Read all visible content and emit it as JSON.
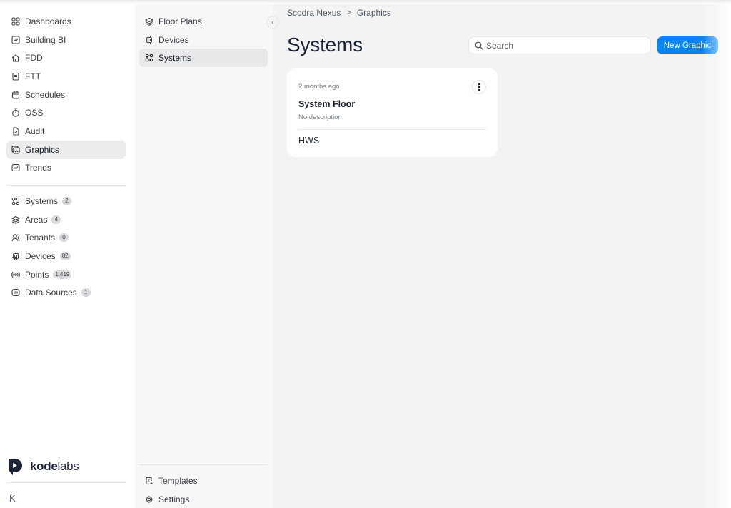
{
  "sidebar": {
    "items": [
      {
        "label": "Dashboards",
        "icon": "dashboard-icon"
      },
      {
        "label": "Building BI",
        "icon": "chart-icon"
      },
      {
        "label": "FDD",
        "icon": "fdd-icon"
      },
      {
        "label": "FTT",
        "icon": "clipboard-icon"
      },
      {
        "label": "Schedules",
        "icon": "calendar-icon"
      },
      {
        "label": "OSS",
        "icon": "timer-icon"
      },
      {
        "label": "Audit",
        "icon": "audit-icon"
      },
      {
        "label": "Graphics",
        "icon": "graphics-icon",
        "active": true
      },
      {
        "label": "Trends",
        "icon": "trends-icon"
      }
    ],
    "entities": [
      {
        "label": "Systems",
        "badge": "2",
        "icon": "systems-icon"
      },
      {
        "label": "Areas",
        "badge": "4",
        "icon": "layers-icon"
      },
      {
        "label": "Tenants",
        "badge": "0",
        "icon": "users-icon"
      },
      {
        "label": "Devices",
        "badge": "82",
        "icon": "chip-icon"
      },
      {
        "label": "Points",
        "badge": "1,419",
        "icon": "broadcast-icon"
      },
      {
        "label": "Data Sources",
        "badge": "1",
        "icon": "datasource-icon"
      }
    ],
    "logo": {
      "bold": "kode",
      "light": "labs"
    },
    "collapse_label": "K"
  },
  "subnav": {
    "items": [
      {
        "label": "Floor Plans",
        "icon": "layers-icon"
      },
      {
        "label": "Devices",
        "icon": "chip-icon"
      },
      {
        "label": "Systems",
        "icon": "systems-icon",
        "active": true
      }
    ],
    "bottom": [
      {
        "label": "Templates",
        "icon": "template-icon"
      },
      {
        "label": "Settings",
        "icon": "gear-icon"
      }
    ],
    "collapse_label": "‹"
  },
  "breadcrumb": {
    "root": "Scodra Nexus",
    "separator": ">",
    "current": "Graphics"
  },
  "main": {
    "title": "Systems",
    "search_placeholder": "Search",
    "new_button": "New Graphic",
    "cards": [
      {
        "time": "2 months ago",
        "title": "System Floor",
        "description": "No description",
        "tag": "HWS"
      }
    ]
  },
  "colors": {
    "accent": "#0a84f0",
    "title": "#1d2336"
  }
}
